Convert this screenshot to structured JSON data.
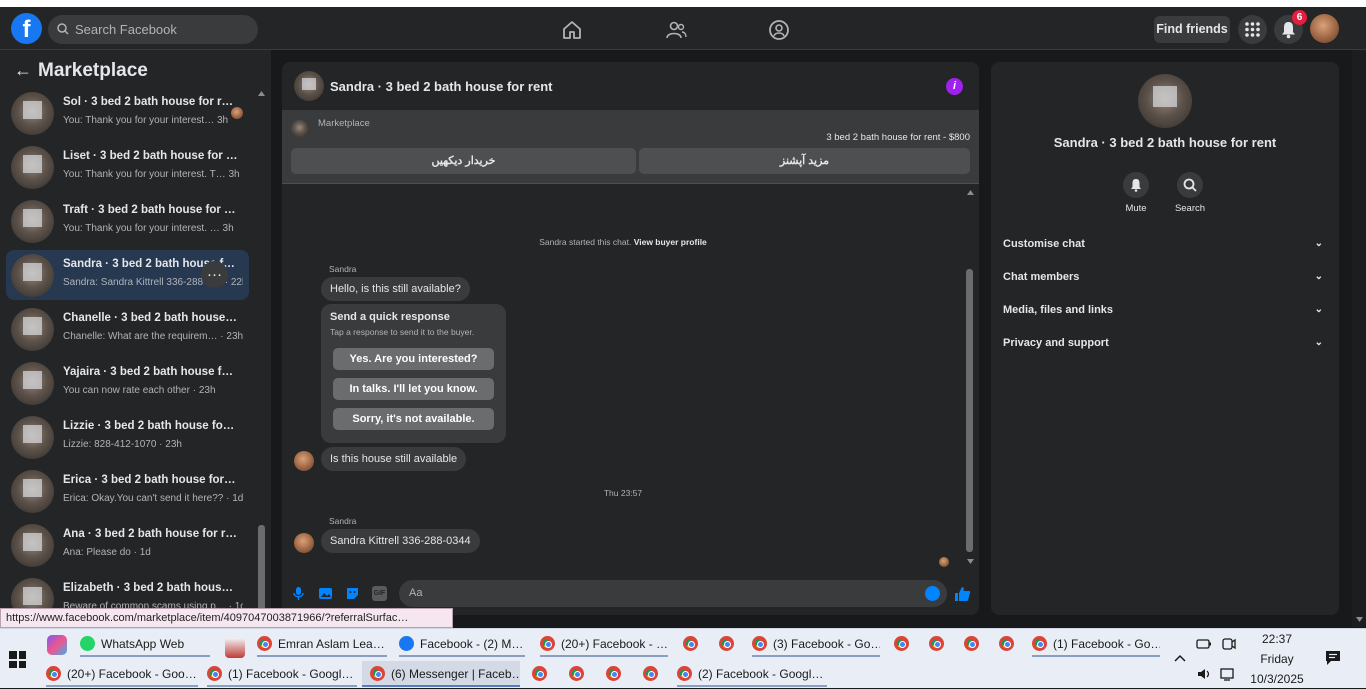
{
  "topbar": {
    "search_placeholder": "Search Facebook",
    "find_friends": "Find friends",
    "notification_count": "6"
  },
  "sidebar": {
    "title": "Marketplace",
    "conversations": [
      {
        "name": "Sol · 3 bed 2 bath house for rent",
        "snippet": "You: Thank you for your interest… 3h"
      },
      {
        "name": "Liset · 3 bed 2 bath house for rent",
        "snippet": "You: Thank you for your interest. T… 3h"
      },
      {
        "name": "Traft · 3 bed 2 bath house for rent",
        "snippet": "You: Thank you for your interest. … 3h"
      },
      {
        "name": "Sandra · 3 bed 2 bath house for rent",
        "snippet": "Sandra: Sandra Kittrell 336-288-0… · 22h"
      },
      {
        "name": "Chanelle · 3 bed 2 bath house for rent",
        "snippet": "Chanelle: What are the requirem… · 23h"
      },
      {
        "name": "Yajaira · 3 bed 2 bath house for rent",
        "snippet": "You can now rate each other · 23h"
      },
      {
        "name": "Lizzie · 3 bed 2 bath house for rent",
        "snippet": "Lizzie: 828-412-1070 · 23h"
      },
      {
        "name": "Erica · 3 bed 2 bath house for rent",
        "snippet": "Erica: Okay.You can't send it here?? · 1d"
      },
      {
        "name": "Ana · 3 bed 2 bath house for rent",
        "snippet": "Ana: Please do · 1d"
      },
      {
        "name": "Elizabeth · 3 bed 2 bath house for rent",
        "snippet": "Beware of common scams using p… · 1d"
      }
    ],
    "more_label": "…"
  },
  "chat": {
    "title": "Sandra · 3 bed 2 bath house for rent",
    "marketplace_label": "Marketplace",
    "listing_price": "3 bed 2 bath house for rent - $800",
    "button_left": "خریدار دیکھیں",
    "button_right": "مزید آپشنز",
    "system_message": "Sandra started this chat.",
    "system_link": "View buyer profile",
    "sender1": "Sandra",
    "msg1": "Hello, is this still available?",
    "quick_title": "Send a quick response",
    "quick_sub": "Tap a response to send it to the buyer.",
    "quick_responses": [
      "Yes. Are you interested?",
      "In talks. I'll let you know.",
      "Sorry, it's not available."
    ],
    "msg2": "Is this house still available",
    "timestamp": "Thu 23:57",
    "sender2": "Sandra",
    "msg3": "Sandra Kittrell 336-288-0344",
    "input_placeholder": "Aa",
    "gif_label": "GIF"
  },
  "info_panel": {
    "title": "Sandra · 3 bed 2 bath house for rent",
    "mute": "Mute",
    "search": "Search",
    "sections": [
      "Customise chat",
      "Chat members",
      "Media, files and links",
      "Privacy and support"
    ]
  },
  "status_url": "https://www.facebook.com/marketplace/item/4097047003871966/?referralSurfac…",
  "taskbar": {
    "items": [
      "WhatsApp Web",
      "Emran Aslam Lea…",
      "Facebook - (2) M…",
      "(20+) Facebook - …",
      "(3) Facebook - Go…",
      "(1) Facebook - Go…",
      "(20+) Facebook - Goo…",
      "(1) Facebook - Googl…",
      "(6) Messenger | Faceb…",
      "(2) Facebook - Googl…"
    ],
    "time": "22:37",
    "day": "Friday",
    "date": "10/3/2025"
  },
  "colors": {
    "facebook_blue": "#1877f2",
    "messenger_blue": "#0084ff",
    "info_purple": "#a020f0",
    "badge_red": "#e41e3f"
  }
}
